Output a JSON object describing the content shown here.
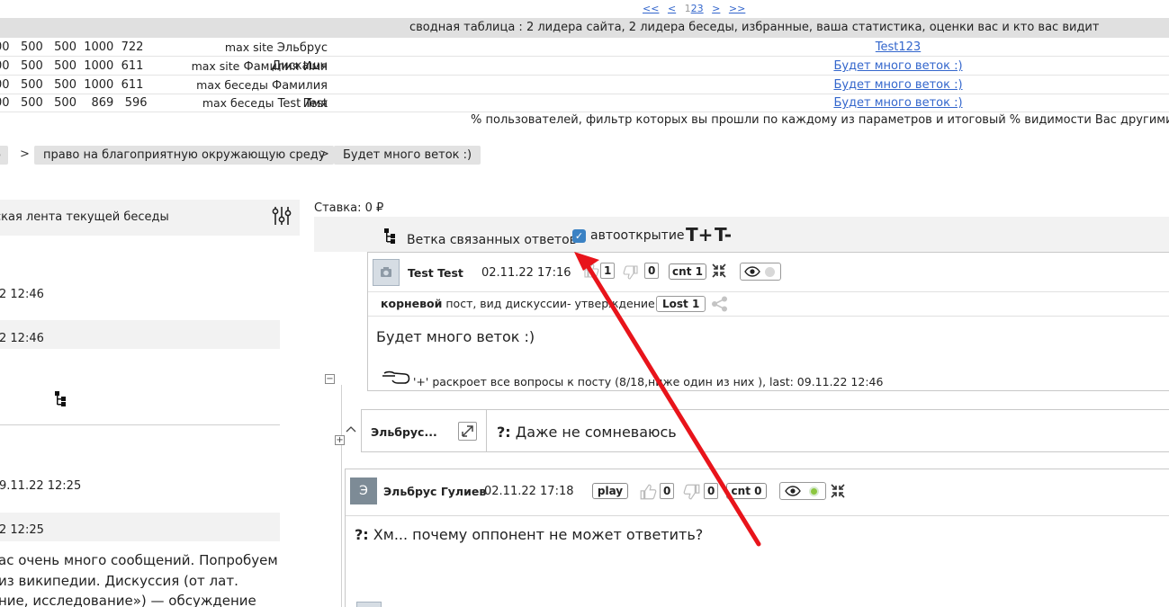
{
  "pager": {
    "first": "<<",
    "prev": "<",
    "current": "1",
    "pages": [
      "2",
      "3"
    ],
    "next": ">",
    "last": ">>"
  },
  "summary": {
    "title": "сводная таблица : 2 лидера сайта, 2 лидера беседы, избранные, ваша статистика, оценки вас и кто вас видит",
    "rows": [
      {
        "nums": "00   500   500  1000  722",
        "kind": "max site",
        "name": "Эльбрус Дискашн",
        "branch": "Test123"
      },
      {
        "nums": "00   500   500  1000  611",
        "kind": "max site",
        "name": "Фамилия Имя",
        "branch": "Будет много веток :)"
      },
      {
        "nums": "00   500   500  1000  611",
        "kind": "max беседы",
        "name": "Фамилия Имя",
        "branch": "Будет много веток :)"
      },
      {
        "nums": "00   500   500    869   596",
        "kind": "max беседы",
        "name": "Test Test",
        "branch": "Будет много веток :)"
      }
    ],
    "percent_note": "% пользователей, фильтр которых вы прошли по каждому из параметров и итоговый % видимости Вас другими участни"
  },
  "breadcrumbs": {
    "items": [
      "о",
      "право на благоприятную окружающую среду",
      "Будет много веток :)"
    ],
    "separator": ">"
  },
  "feed": {
    "header": "ская лента текущей беседы",
    "times": [
      "2 12:46",
      "2 12:46",
      "9.11.22 12:25",
      "2 12:25"
    ],
    "text_lines": [
      "ас очень много сообщений. Попробуем",
      "из википедии. Дискуссия (от лат.",
      "ние, исследование») — обсуждение"
    ]
  },
  "thread": {
    "bet": "Ставка: 0 ₽",
    "branch_title": "Ветка связанных ответов",
    "autoopen_label": "автооткрытие",
    "autoopen_checked": true,
    "font_plus": "T+",
    "font_minus": "T-",
    "root_post": {
      "author": "Test Test",
      "date": "02.11.22 17:16",
      "likes": "1",
      "dislikes": "0",
      "cnt": "cnt 1",
      "meta_bold": "корневой",
      "meta_rest": "пост, вид дискуссии- утверждение",
      "lost": "Lost 1",
      "body": "Будет много веток :)",
      "expand_hint": "'+' раскроет все вопросы к посту (8/18,ниже один из них ), last: 09.11.22 12:46"
    },
    "reply": {
      "author": "Эльбрус...",
      "prefix": "?:",
      "text": "Даже не сомневаюсь"
    },
    "post2": {
      "avatar_letter": "Э",
      "author": "Эльбрус Гулиев",
      "date": "02.11.22 17:18",
      "play": "play",
      "likes": "0",
      "dislikes": "0",
      "cnt": "cnt 0",
      "prefix": "?:",
      "body": "Хм... почему оппонент не может ответить?"
    }
  },
  "colors": {
    "annotation_arrow": "#e8141b",
    "checkbox": "#3b82c4",
    "link": "#3366cc",
    "status_dot_green": "#8cc63f",
    "status_dot_grey": "#d8d8d8"
  }
}
